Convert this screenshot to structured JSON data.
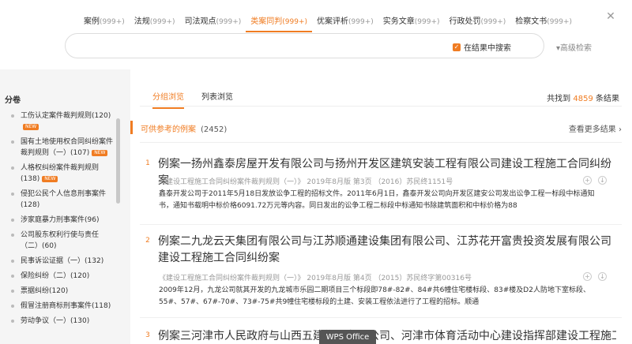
{
  "nav_tabs": [
    {
      "label": "案例",
      "count": "(999+)"
    },
    {
      "label": "法规",
      "count": "(999+)"
    },
    {
      "label": "司法观点",
      "count": "(999+)"
    },
    {
      "label": "类案同判",
      "count": "(999+)"
    },
    {
      "label": "优案评析",
      "count": "(999+)"
    },
    {
      "label": "实务文章",
      "count": "(999+)"
    },
    {
      "label": "行政处罚",
      "count": "(999+)"
    },
    {
      "label": "检察文书",
      "count": "(999+)"
    }
  ],
  "search": {
    "placeholder": "",
    "scope_label": "在结果中搜索",
    "advanced_label": "▾高级检索"
  },
  "sidebar": {
    "heading": "分卷",
    "items": [
      {
        "label": "工伤认定案件裁判规则(120)",
        "new": "NEW"
      },
      {
        "label": "国有土地使用权合同纠纷案件裁判规则（一）(107)",
        "new": "NEW"
      },
      {
        "label": "人格权纠纷案件裁判规则(138)",
        "new": "NEW"
      },
      {
        "label": "侵犯公民个人信息刑事案件(128)",
        "new": ""
      },
      {
        "label": "涉家庭暴力刑事案件(96)",
        "new": ""
      },
      {
        "label": "公司股东权利行使与责任（二）(60)",
        "new": ""
      },
      {
        "label": "民事诉讼证据（一）(132)",
        "new": ""
      },
      {
        "label": "保险纠纷（二）(120)",
        "new": ""
      },
      {
        "label": "票据纠纷(120)",
        "new": ""
      },
      {
        "label": "假冒注册商标刑事案件(118)",
        "new": ""
      },
      {
        "label": "劳动争议（一）(130)",
        "new": ""
      }
    ]
  },
  "main": {
    "subtabs": [
      "分组浏览",
      "列表浏览"
    ],
    "found_prefix": "共找到",
    "found_count": "4859",
    "found_suffix": "条结果",
    "category_title": "可供参考的例案",
    "category_count": "(2452)",
    "more_label": "查看更多结果 ›",
    "cases": [
      {
        "num": "1",
        "title": "例案一扬州鑫泰房屋开发有限公司与扬州开发区建筑安装工程有限公司建设工程施工合同纠纷案",
        "meta": "《建设工程施工合同纠纷案件裁判规则（一）》 2019年8月版 第3页 （2016）苏民终1151号",
        "summary": "鑫泰开发公司于2011年5月18日发放讼争工程的招标文件。2011年6月1日，鑫泰开发公司向开发区建安公司发出讼争工程一标段中标通知书，通知书载明中标价格6091.72万元等内容。同日发出的讼争工程二标段中标通知书除建筑面积和中标价格为88"
      },
      {
        "num": "2",
        "title": "例案二九龙云天集团有限公司与江苏顺通建设集团有限公司、江苏花开富贵投资发展有限公司建设工程施工合同纠纷案",
        "meta": "《建设工程施工合同纠纷案件裁判规则（一）》 2019年8月版 第4页 （2015）苏民终字第00316号",
        "summary": "2009年12月，九龙公司就其开发的九龙城市乐园二期项目三个标段即78#-82#、84#共6幢住宅楼标段、83#楼及D2人防地下室标段、55#、57#、67#-70#、73#-75#共9幢住宅楼标段的土建、安装工程依法进行了工程的招标。顺通"
      },
      {
        "num": "3",
        "title": "例案三河津市人民政府与山西五建集团有限公司、河津市体育活动中心建设指挥部建设工程施工",
        "meta": "",
        "summary": ""
      }
    ]
  },
  "taskbar_label": "WPS Office",
  "accent_color": "#f07c22"
}
